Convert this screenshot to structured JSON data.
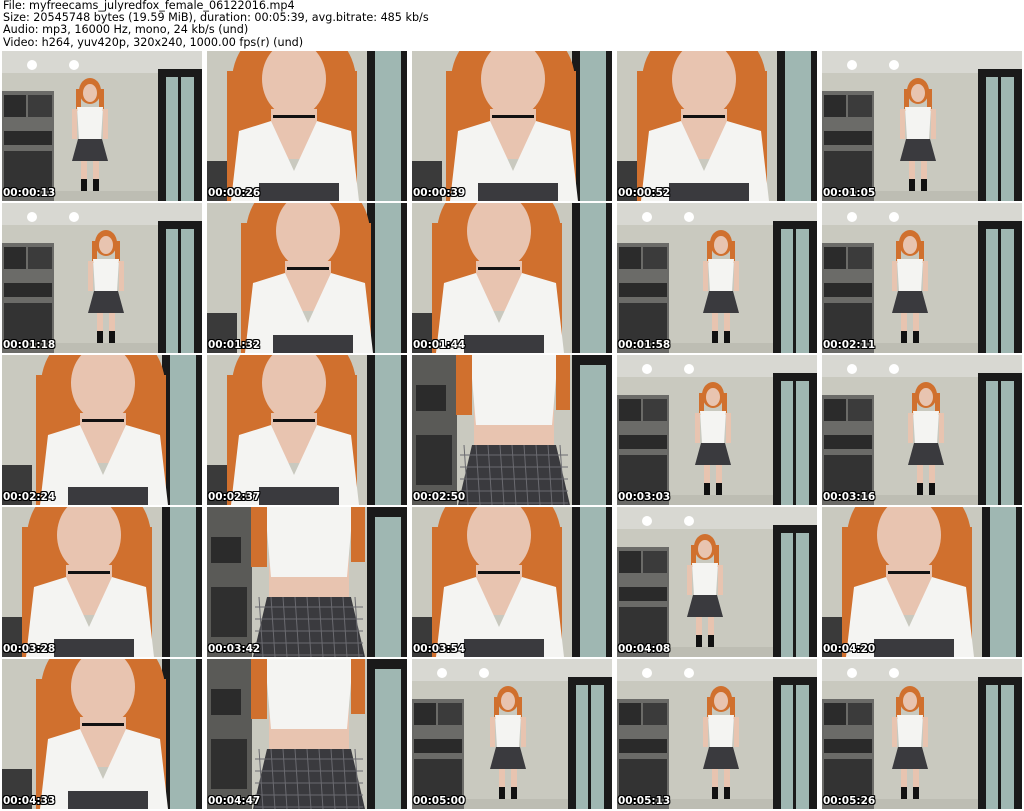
{
  "header": {
    "file": "File: myfreecams_julyredfox_female_06122016.mp4",
    "size": "Size: 20545748 bytes (19.59 MiB), duration: 00:05:39, avg.bitrate: 485 kb/s",
    "audio": "Audio: mp3, 16000 Hz, mono, 24 kb/s (und)",
    "video": "Video: h264, yuv420p, 320x240, 1000.00 fps(r) (und)"
  },
  "frames": [
    {
      "timestamp": "00:00:13",
      "shot": "wide"
    },
    {
      "timestamp": "00:00:26",
      "shot": "close"
    },
    {
      "timestamp": "00:00:39",
      "shot": "close"
    },
    {
      "timestamp": "00:00:52",
      "shot": "close"
    },
    {
      "timestamp": "00:01:05",
      "shot": "wide"
    },
    {
      "timestamp": "00:01:18",
      "shot": "wide"
    },
    {
      "timestamp": "00:01:32",
      "shot": "close"
    },
    {
      "timestamp": "00:01:44",
      "shot": "close"
    },
    {
      "timestamp": "00:01:58",
      "shot": "wide"
    },
    {
      "timestamp": "00:02:11",
      "shot": "wide"
    },
    {
      "timestamp": "00:02:24",
      "shot": "close"
    },
    {
      "timestamp": "00:02:37",
      "shot": "close"
    },
    {
      "timestamp": "00:02:50",
      "shot": "mid"
    },
    {
      "timestamp": "00:03:03",
      "shot": "wide"
    },
    {
      "timestamp": "00:03:16",
      "shot": "wide"
    },
    {
      "timestamp": "00:03:28",
      "shot": "close"
    },
    {
      "timestamp": "00:03:42",
      "shot": "mid"
    },
    {
      "timestamp": "00:03:54",
      "shot": "close"
    },
    {
      "timestamp": "00:04:08",
      "shot": "wide"
    },
    {
      "timestamp": "00:04:20",
      "shot": "close"
    },
    {
      "timestamp": "00:04:33",
      "shot": "close"
    },
    {
      "timestamp": "00:04:47",
      "shot": "mid"
    },
    {
      "timestamp": "00:05:00",
      "shot": "wide"
    },
    {
      "timestamp": "00:05:13",
      "shot": "wide"
    },
    {
      "timestamp": "00:05:26",
      "shot": "wide"
    }
  ],
  "colors": {
    "wall": "#c9c9bf",
    "door": "#1a1a1a",
    "glass": "#9fb7b2",
    "hair": "#d0702e",
    "skin": "#e8c4b0",
    "shirt": "#f4f4f2",
    "skirt": "#3a3a3e",
    "kitchen": "#2b2b2b"
  }
}
